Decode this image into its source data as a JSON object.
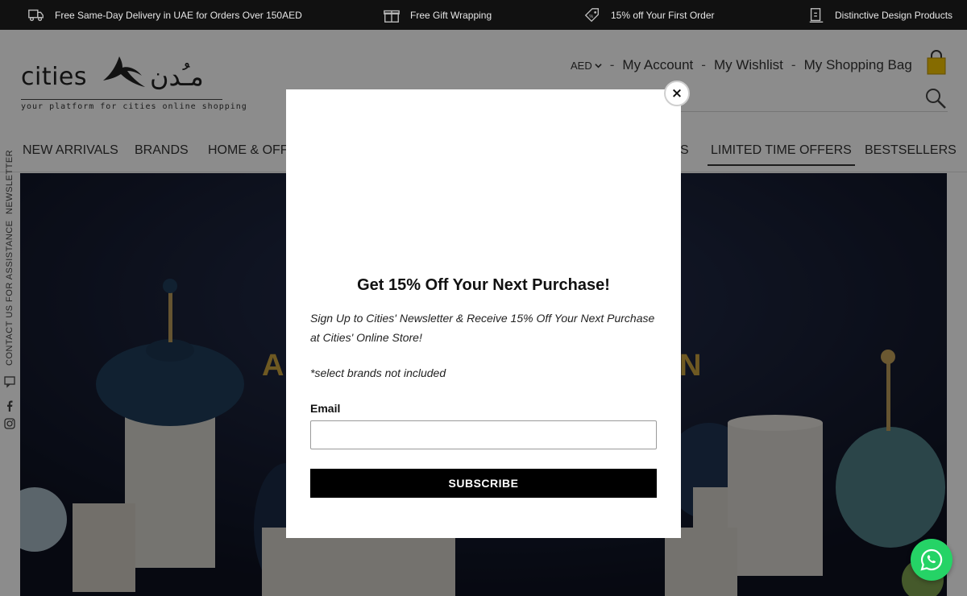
{
  "promo_bar": {
    "items": [
      {
        "icon": "delivery-truck-icon",
        "text": "Free Same-Day Delivery in UAE for Orders Over 150AED"
      },
      {
        "icon": "gift-icon",
        "text": "Free Gift Wrapping"
      },
      {
        "icon": "discount-tag-icon",
        "text": "15% off Your First Order"
      },
      {
        "icon": "design-product-icon",
        "text": "Distinctive Design Products"
      }
    ]
  },
  "header": {
    "logo": {
      "english": "cities",
      "arabic": "مـُدن",
      "tagline": "your platform for cities online shopping"
    },
    "currency": "AED",
    "separator": "-",
    "links": {
      "account": "My Account",
      "wishlist": "My Wishlist",
      "bag": "My Shopping Bag"
    }
  },
  "nav": {
    "items": [
      {
        "label": "NEW ARRIVALS"
      },
      {
        "label": "BRANDS"
      },
      {
        "label": "HOME & OFF"
      },
      {
        "label": "S"
      },
      {
        "label": "LIMITED TIME OFFERS"
      },
      {
        "label": "BESTSELLERS"
      }
    ],
    "active_index": 4
  },
  "side_links": {
    "newsletter": "NEWSLETTER",
    "contact": "CONTACT US FOR ASSISTANCE"
  },
  "hero": {
    "title_left": "A",
    "title_right": "N"
  },
  "modal": {
    "title": "Get 15% Off Your Next Purchase!",
    "text": "Sign Up to Cities' Newsletter & Receive 15% Off Your Next Purchase at Cities' Online Store!",
    "note": "*select brands not included",
    "email_label": "Email",
    "email_value": "",
    "subscribe_label": "SUBSCRIBE",
    "close_symbol": "×"
  },
  "colors": {
    "topbar_bg": "#111111",
    "hero_bg": "#13182b",
    "gold": "#c9a23f",
    "whatsapp": "#25d366",
    "bag_yellow": "#f2c300"
  }
}
